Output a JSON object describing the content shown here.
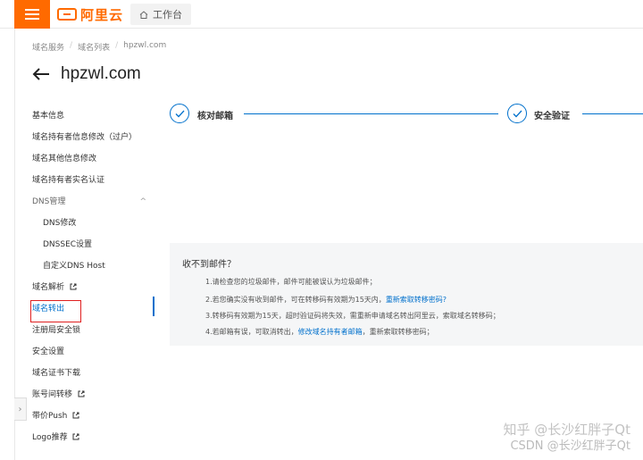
{
  "header": {
    "logo_text": "阿里云",
    "workbench_label": "工作台"
  },
  "breadcrumb": [
    "域名服务",
    "域名列表",
    "hpzwl.com"
  ],
  "page_title": "hpzwl.com",
  "sidebar": {
    "items": [
      {
        "label": "基本信息"
      },
      {
        "label": "域名持有者信息修改（过户）"
      },
      {
        "label": "域名其他信息修改"
      },
      {
        "label": "域名持有者实名认证"
      },
      {
        "label": "DNS管理"
      },
      {
        "label": "DNS修改"
      },
      {
        "label": "DNSSEC设置"
      },
      {
        "label": "自定义DNS Host"
      },
      {
        "label": "域名解析"
      },
      {
        "label": "域名转出"
      },
      {
        "label": "注册局安全锁"
      },
      {
        "label": "安全设置"
      },
      {
        "label": "域名证书下载"
      },
      {
        "label": "账号间转移"
      },
      {
        "label": "带价Push"
      },
      {
        "label": "Logo推荐"
      }
    ]
  },
  "steps": [
    {
      "label": "核对邮箱"
    },
    {
      "label": "安全验证"
    }
  ],
  "tips": {
    "title": "收不到邮件？",
    "line1": "1.请检查您的垃圾邮件，邮件可能被误认为垃圾邮件；",
    "line2_text": "2.若您确实没有收到邮件，可在转移码有效期为15天内，",
    "line2_link": "重新索取转移密码?",
    "line3": "3.转移码有效期为15天，超时验证码将失效，需重新申请域名转出阿里云，索取域名转移码；",
    "line4_text_a": "4.若邮箱有误，可取消转出，",
    "line4_link": "修改域名持有者邮箱",
    "line4_text_b": "，重新索取转移密码；"
  },
  "watermark": {
    "line1": "知乎 @长沙红胖子Qt",
    "line2": "CSDN @长沙红胖子Qt"
  },
  "colors": {
    "brand": "#ff6a00",
    "link": "#0070cc",
    "highlight_outline": "#e02020"
  }
}
